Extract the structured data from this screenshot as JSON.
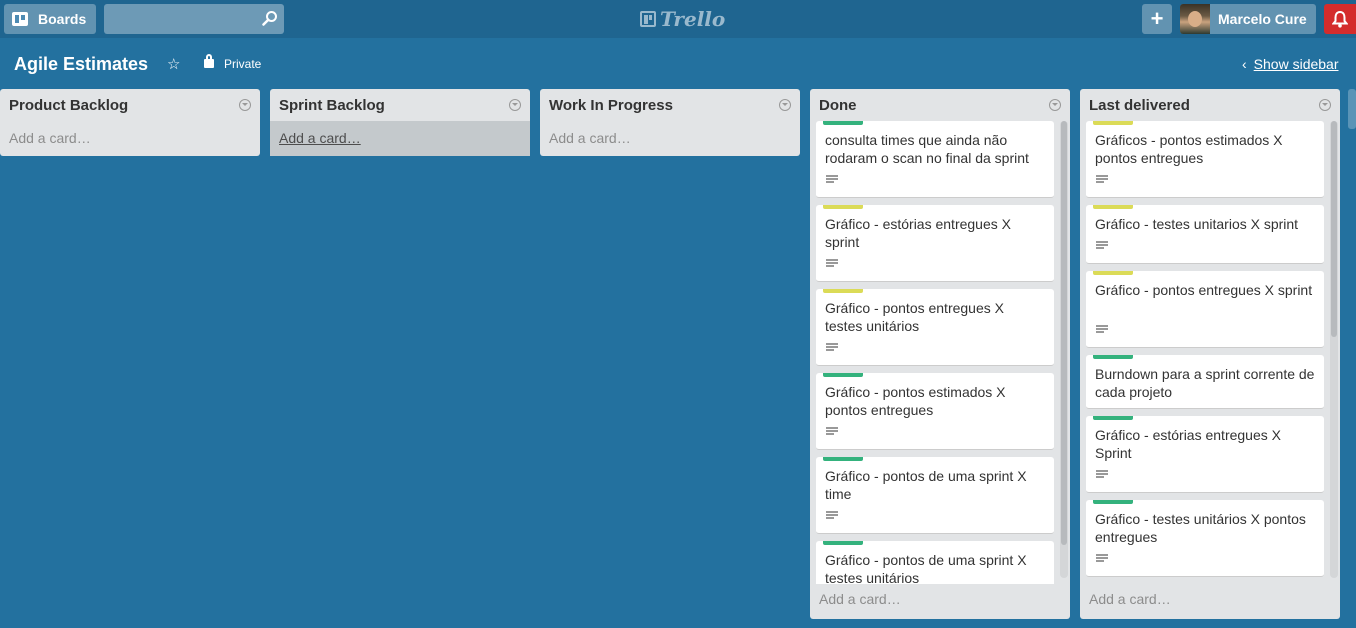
{
  "header": {
    "boards_label": "Boards",
    "search_value": "",
    "logo_text": "Trello",
    "user_name": "Marcelo Cure",
    "add_symbol": "+"
  },
  "board": {
    "title": "Agile Estimates",
    "visibility": "Private",
    "show_sidebar_label": "Show sidebar"
  },
  "colors": {
    "label_yellow": "#dbdb57",
    "label_green": "#34b27d",
    "notification_red": "#d42c2c"
  },
  "lists": [
    {
      "title": "Product Backlog",
      "add_card": "Add a card…",
      "cards": []
    },
    {
      "title": "Sprint Backlog",
      "add_card": "Add a card…",
      "cards": []
    },
    {
      "title": "Work In Progress",
      "add_card": "Add a card…",
      "cards": []
    },
    {
      "title": "Done",
      "add_card": "Add a card…",
      "cards": [
        {
          "title": "consulta times que ainda não rodaram o scan no final da sprint",
          "label": "green",
          "has_description": true
        },
        {
          "title": "Gráfico - estórias entregues X sprint",
          "label": "yellow",
          "has_description": true
        },
        {
          "title": "Gráfico - pontos entregues X testes unitários",
          "label": "yellow",
          "has_description": true
        },
        {
          "title": "Gráfico - pontos estimados X pontos entregues",
          "label": "green",
          "has_description": true
        },
        {
          "title": "Gráfico - pontos de uma sprint X time",
          "label": "green",
          "has_description": true
        },
        {
          "title": "Gráfico - pontos de uma sprint X testes unitários",
          "label": "green",
          "has_description": false
        }
      ]
    },
    {
      "title": "Last delivered",
      "add_card": "Add a card…",
      "cards": [
        {
          "title": "Gráficos - pontos estimados X pontos entregues",
          "label": "yellow",
          "has_description": true
        },
        {
          "title": "Gráfico - testes unitarios X sprint",
          "label": "yellow",
          "has_description": true
        },
        {
          "title": "Gráfico - pontos entregues X sprint",
          "label": "yellow",
          "has_description": true
        },
        {
          "title": "Burndown para a sprint corrente de cada projeto",
          "label": "green",
          "has_description": false
        },
        {
          "title": "Gráfico - estórias entregues X Sprint",
          "label": "green",
          "has_description": true
        },
        {
          "title": "Gráfico - testes unitários X pontos entregues",
          "label": "green",
          "has_description": true
        },
        {
          "title": "",
          "label": "yellow",
          "has_description": false
        }
      ]
    }
  ]
}
